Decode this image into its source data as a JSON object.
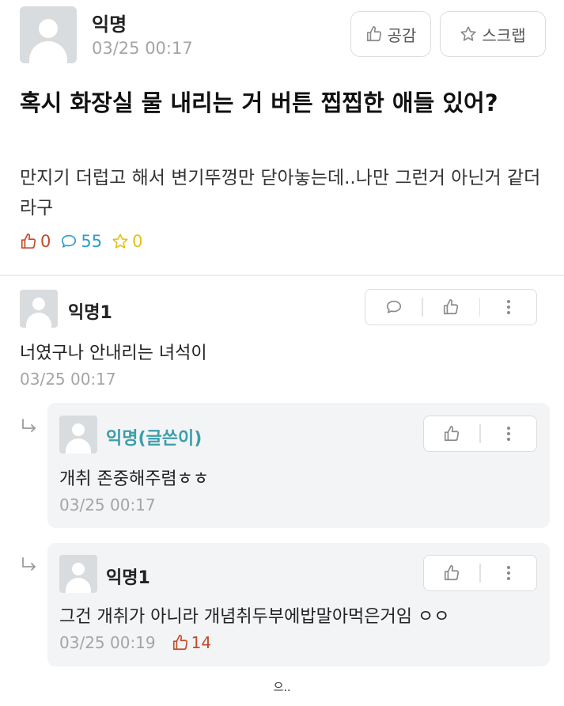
{
  "post": {
    "author": "익명",
    "time": "03/25 00:17",
    "like_button": "공감",
    "scrap_button": "스크랩",
    "title": "혹시 화장실 물 내리는 거 버튼 찝찝한 애들 있어?",
    "content": "만지기 더럽고 해서 변기뚜껑만 닫아놓는데..나만 그런거 아닌거 같더라구",
    "stats": {
      "likes": "0",
      "comments": "55",
      "scraps": "0"
    }
  },
  "comments": [
    {
      "author": "익명1",
      "text": "너였구나 안내리는 녀석이",
      "time": "03/25 00:17"
    }
  ],
  "replies": [
    {
      "author": "익명(글쓴이)",
      "text": "개취 존중해주렴ㅎㅎ",
      "time": "03/25 00:17"
    },
    {
      "author": "익명1",
      "text": "그건 개취가 아니라 개념취두부에밥말아먹은거임 ㅇㅇ",
      "time": "03/25 00:19",
      "likes": "14"
    }
  ],
  "footer": "으..",
  "colors": {
    "accent_like": "#c34a2a",
    "accent_comment": "#2e9ecb",
    "accent_scrap": "#e2c11a",
    "op_name": "#3d9eab"
  },
  "icons": [
    "thumbs-up-icon",
    "star-icon",
    "speech-bubble-icon",
    "more-vertical-icon",
    "reply-arrow-icon"
  ]
}
